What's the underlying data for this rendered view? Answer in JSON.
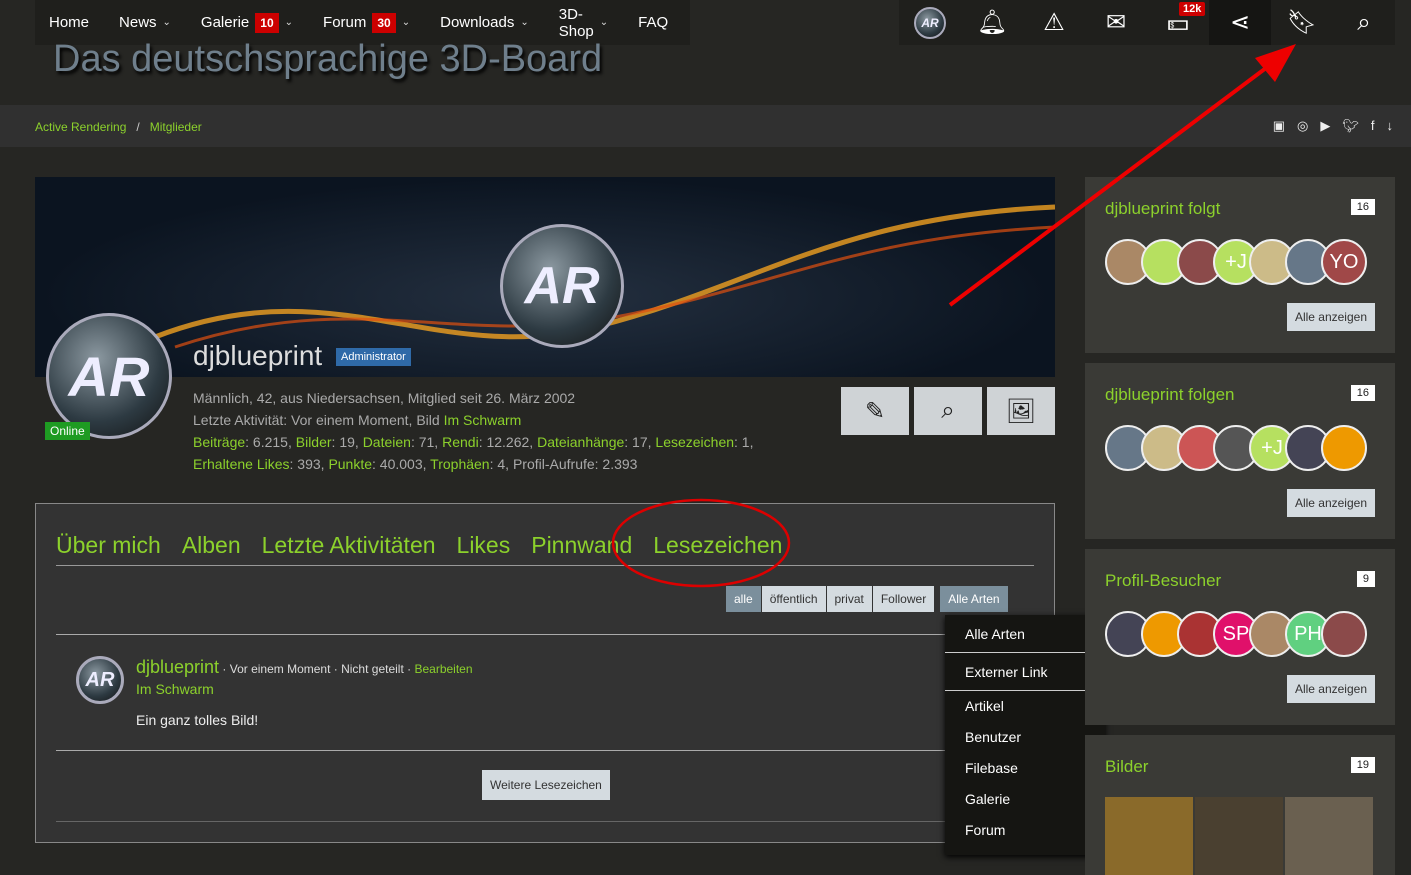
{
  "nav": {
    "items": [
      {
        "label": "Home"
      },
      {
        "label": "News",
        "dropdown": true
      },
      {
        "label": "Galerie",
        "badge": "10",
        "dropdown": true
      },
      {
        "label": "Forum",
        "badge": "30",
        "dropdown": true
      },
      {
        "label": "Downloads",
        "dropdown": true
      },
      {
        "label": "3D-Shop",
        "dropdown": true
      },
      {
        "label": "FAQ"
      }
    ]
  },
  "user_icons": {
    "cash_badge": "12k"
  },
  "logo": "Das deutschsprachige 3D-Board",
  "breadcrumb": [
    "Active Rendering",
    "/",
    "Mitglieder"
  ],
  "profile": {
    "name": "djblueprint",
    "rank": "Administrator",
    "online": "Online",
    "line1": "Männlich, 42, aus Niedersachsen, Mitglied seit 26. März 2002",
    "line2_prefix": "Letzte Aktivität: Vor einem Moment, Bild ",
    "line2_link": "Im Schwarm",
    "stats": [
      [
        "Beiträge",
        ": 6.215, "
      ],
      [
        "Bilder",
        ": 19, "
      ],
      [
        "Dateien",
        ": 71, "
      ],
      [
        "Rendi",
        ": 12.262, "
      ],
      [
        "Dateianhänge",
        ": 17, "
      ],
      [
        "Lesezeichen",
        ": 1,"
      ]
    ],
    "stats2": [
      [
        "Erhaltene Likes",
        ": 393, "
      ],
      [
        "Punkte",
        ": 40.003, "
      ],
      [
        "Trophäen",
        ": 4, "
      ],
      [
        "",
        "Profil-Aufrufe: 2.393"
      ]
    ]
  },
  "tabs": [
    "Über mich",
    "Alben",
    "Letzte Aktivitäten",
    "Likes",
    "Pinnwand",
    "Lesezeichen"
  ],
  "filters": [
    "alle",
    "öffentlich",
    "privat",
    "Follower"
  ],
  "type_filter": "Alle Arten",
  "entry": {
    "author": "djblueprint",
    "meta": " · Vor einem Moment · Nicht geteilt · ",
    "edit": "Bearbeiten",
    "title": "Im Schwarm",
    "text": "Ein ganz tolles Bild!"
  },
  "more_button": "Weitere Lesezeichen",
  "dropdown": [
    "Alle Arten",
    "Externer Link",
    "Artikel",
    "Benutzer",
    "Filebase",
    "Galerie",
    "Forum"
  ],
  "sidebar": [
    {
      "title": "djblueprint folgt",
      "count": "16",
      "avatars": [
        "",
        "",
        "",
        "+J",
        "",
        "",
        "YO"
      ],
      "button": "Alle anzeigen"
    },
    {
      "title": "djblueprint folgen",
      "count": "16",
      "avatars": [
        "",
        "",
        "",
        "",
        "+J",
        "",
        ""
      ],
      "button": "Alle anzeigen"
    },
    {
      "title": "Profil-Besucher",
      "count": "9",
      "avatars": [
        "",
        "",
        "",
        "SP",
        "",
        "PH",
        ""
      ],
      "button": "Alle anzeigen"
    },
    {
      "title": "Bilder",
      "count": "19"
    }
  ]
}
